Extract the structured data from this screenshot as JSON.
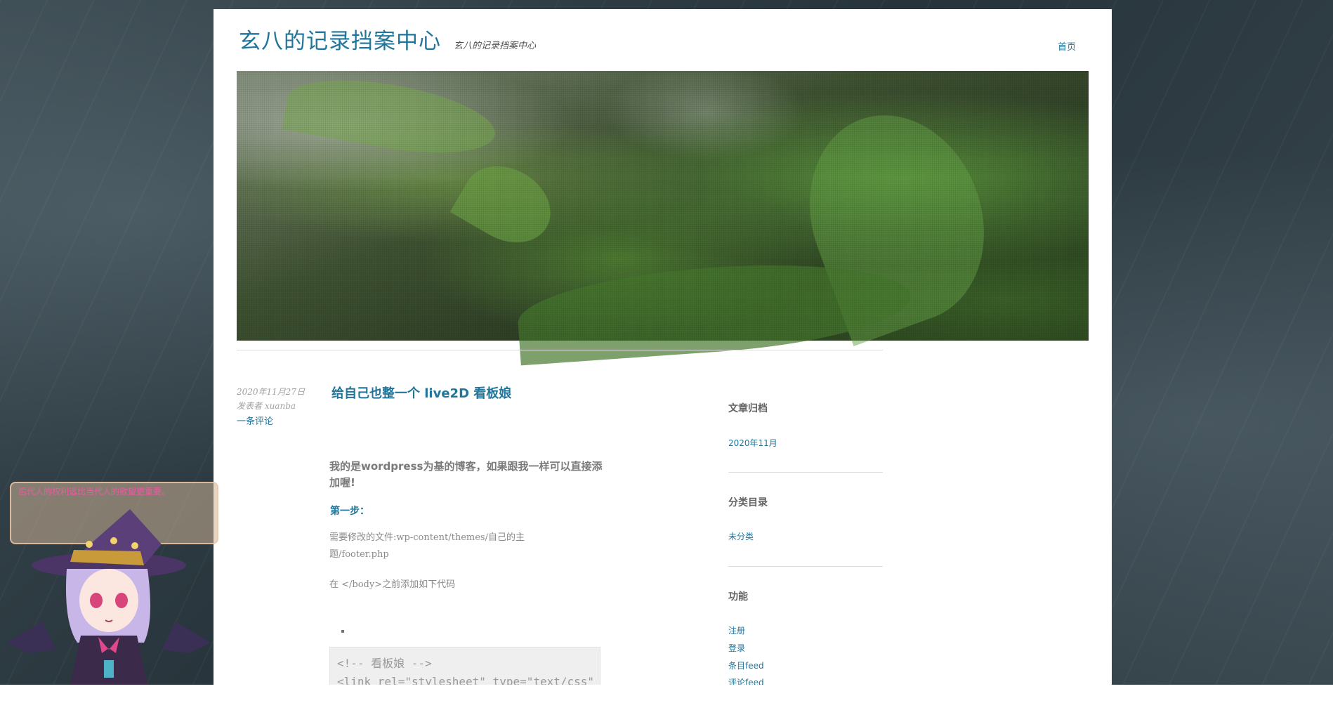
{
  "site": {
    "title": "玄八的记录挡案中心",
    "description": "玄八的记录挡案中心",
    "nav_home": "首页"
  },
  "post": {
    "date": "2020年11月27日",
    "author": "发表者 xuanba",
    "comments": "一条评论",
    "title": "给自己也整一个 live2D 看板娘",
    "intro": "我的是wordpress为基的博客，如果跟我一样可以直接添加喔!",
    "step": "第一步：",
    "file_line": "需要修改的文件:wp-content/themes/自己的主题/footer.php",
    "before_body": "在 </body>之前添加如下代码",
    "code_line1": "<!-- 看板娘 -->",
    "code_line2": "<link rel=\"stylesheet\" type=\"text/css\""
  },
  "sidebar": {
    "archives_title": "文章归档",
    "archives_items": [
      "2020年11月"
    ],
    "categories_title": "分类目录",
    "categories_items": [
      "未分类"
    ],
    "meta_title": "功能",
    "meta_items": [
      "注册",
      "登录",
      "条目feed",
      "评论feed"
    ]
  },
  "mascot": {
    "message": "后代人的权利远比当代人的欲望更重要。"
  },
  "colors": {
    "link": "#21759b",
    "mascot_text": "#e75ea0"
  }
}
